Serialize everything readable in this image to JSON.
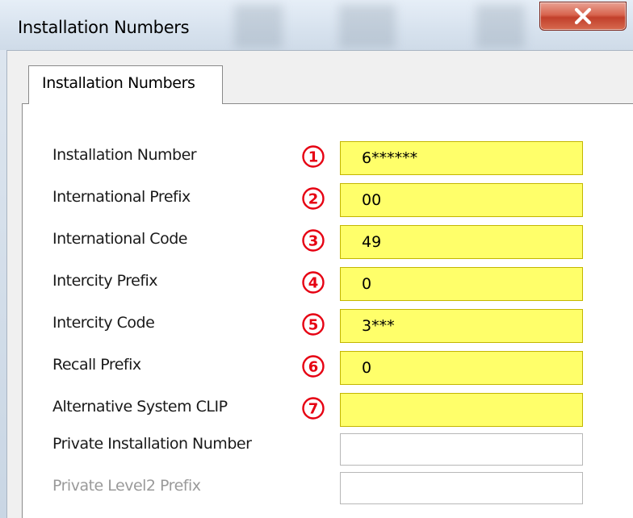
{
  "window": {
    "title": "Installation Numbers",
    "titlebar_color": "#dbe5f0",
    "close_button_color": "#c94a34"
  },
  "tabs": [
    {
      "label": "Installation Numbers",
      "selected": true
    }
  ],
  "badge_color": "#e60012",
  "field_highlight_color": "#ffff6a",
  "rows": [
    {
      "label": "Installation Number",
      "badge": "1",
      "value": "6******",
      "highlighted": true,
      "disabled": false
    },
    {
      "label": "International Prefix",
      "badge": "2",
      "value": "00",
      "highlighted": true,
      "disabled": false
    },
    {
      "label": "International Code",
      "badge": "3",
      "value": "49",
      "highlighted": true,
      "disabled": false
    },
    {
      "label": "Intercity Prefix",
      "badge": "4",
      "value": "0",
      "highlighted": true,
      "disabled": false
    },
    {
      "label": "Intercity Code",
      "badge": "5",
      "value": "3***",
      "highlighted": true,
      "disabled": false
    },
    {
      "label": "Recall Prefix",
      "badge": "6",
      "value": "0",
      "highlighted": true,
      "disabled": false
    },
    {
      "label": "Alternative System CLIP",
      "badge": "7",
      "value": "",
      "highlighted": true,
      "disabled": false
    },
    {
      "label": "Private Installation Number",
      "badge": "",
      "value": "",
      "highlighted": false,
      "disabled": false
    },
    {
      "label": "Private Level2 Prefix",
      "badge": "",
      "value": "",
      "highlighted": false,
      "disabled": true
    }
  ]
}
